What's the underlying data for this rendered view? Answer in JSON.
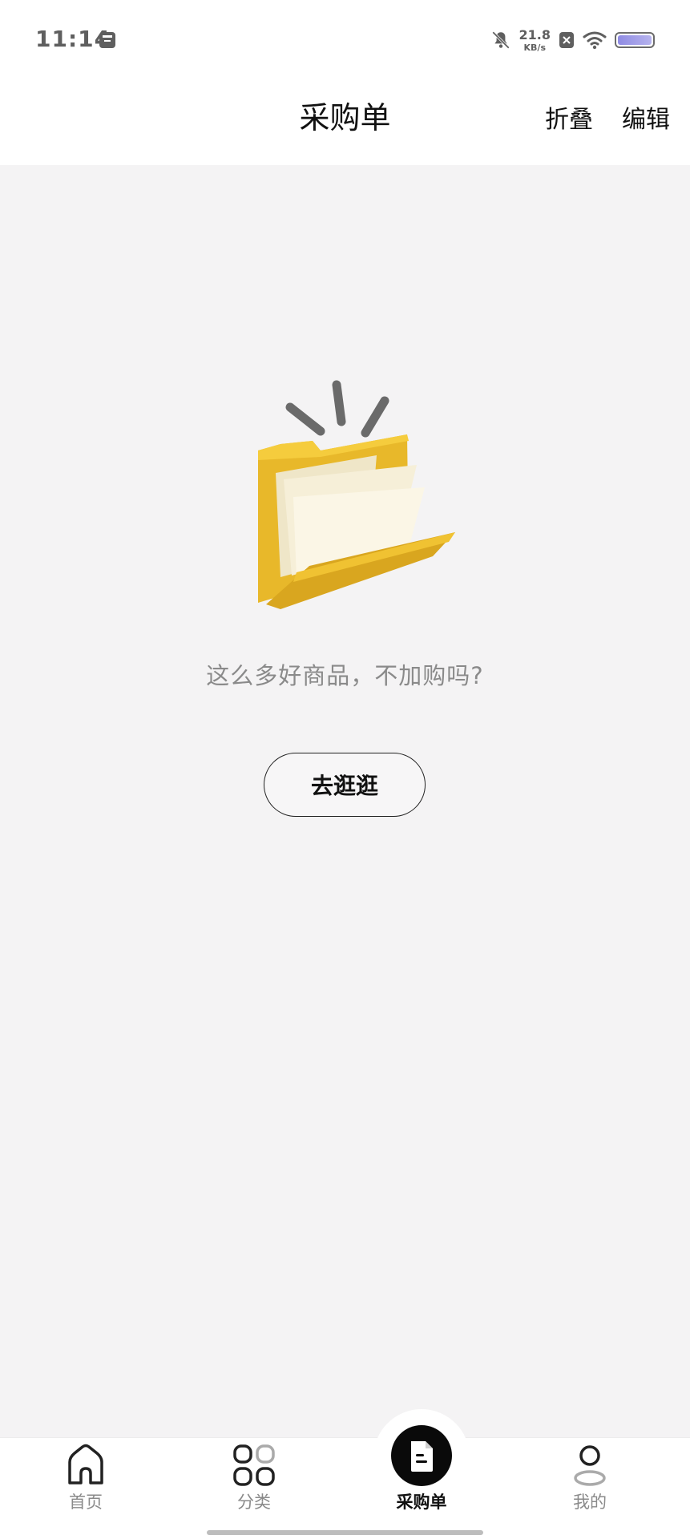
{
  "status_bar": {
    "time": "11:14",
    "network_speed_value": "21.8",
    "network_speed_unit": "KB/s",
    "battery_level": 1.0
  },
  "header": {
    "title": "采购单",
    "fold_label": "折叠",
    "edit_label": "编辑"
  },
  "empty_state": {
    "message": "这么多好商品，不加购吗?",
    "button_label": "去逛逛"
  },
  "bottom_nav": {
    "items": [
      {
        "label": "首页",
        "icon": "home-icon",
        "active": false
      },
      {
        "label": "分类",
        "icon": "category-icon",
        "active": false
      },
      {
        "label": "采购单",
        "icon": "purchase-order-icon",
        "active": true
      },
      {
        "label": "我的",
        "icon": "profile-icon",
        "active": false
      }
    ]
  },
  "colors": {
    "background": "#f4f3f4",
    "surface": "#ffffff",
    "text_primary": "#111111",
    "text_secondary": "#8a8a8a",
    "folder_yellow": "#f2c531"
  }
}
